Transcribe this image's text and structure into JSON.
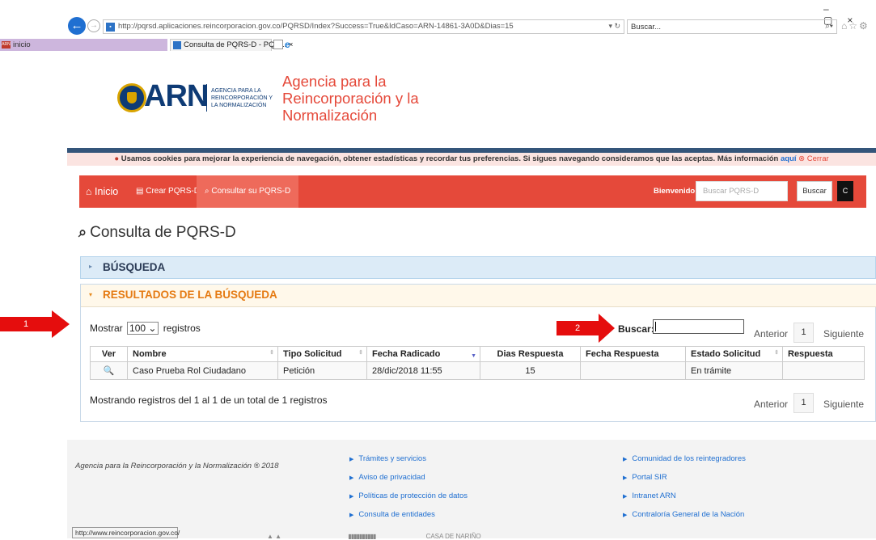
{
  "browser": {
    "url": "http://pqrsd.aplicaciones.reincorporacion.gov.co/PQRSD/Index?Success=True&IdCaso=ARN-14861-3A0D&Dias=15",
    "search_placeholder": "Buscar...",
    "address_controls": "▾ ↻",
    "fav_inicio": "inicio",
    "fav_inicio_logo": "ARN",
    "tab_title": "Consulta de PQRS-D - PQR... ×",
    "status_url": "http://www.reincorporacion.gov.co/"
  },
  "header": {
    "logo_text": "ARN",
    "logo_sub": "AGENCIA PARA LA REINCORPORACIÓN Y LA NORMALIZACIÓN",
    "agency_title": "Agencia para la Reincorporación y la Normalización"
  },
  "cookie": {
    "text": "Usamos cookies para mejorar la experiencia de navegación, obtener estadísticas y recordar tus preferencias. Si sigues navegando consideramos que las aceptas. Más información",
    "link": "aquí",
    "close": "Cerrar"
  },
  "nav": {
    "inicio": "Inicio",
    "crear": "Crear PQRS-D",
    "consultar": "Consultar su PQRS-D",
    "bienvenido": "Bienvenido",
    "search_placeholder": "Buscar PQRS-D",
    "buscar_btn": "Buscar",
    "c_btn": "C"
  },
  "page": {
    "title": "Consulta de PQRS-D"
  },
  "panels": {
    "busqueda": "BÚSQUEDA",
    "resultados": "RESULTADOS DE LA BÚSQUEDA"
  },
  "controls": {
    "mostrar": "Mostrar",
    "page_size": "100",
    "registros": "registros",
    "buscar": "Buscar:",
    "anterior": "Anterior",
    "page": "1",
    "siguiente": "Siguiente"
  },
  "table": {
    "headers": [
      "Ver",
      "Nombre",
      "Tipo Solicitud",
      "Fecha Radicado",
      "Dias Respuesta",
      "Fecha Respuesta",
      "Estado Solicitud",
      "Respuesta"
    ],
    "rows": [
      [
        "🔍",
        "Caso Prueba Rol Ciudadano",
        "Petición",
        "28/dic/2018 11:55",
        "15",
        "",
        "En trámite",
        ""
      ]
    ]
  },
  "results_info": "Mostrando registros del 1 al 1 de un total de 1 registros",
  "annotations": {
    "first": "1",
    "second": "2"
  },
  "footer": {
    "copyright": "Agencia para la Reincorporación y la Normalización ® 2018",
    "links_col1": [
      "Trámites y servicios",
      "Aviso de privacidad",
      "Políticas de protección de datos",
      "Consulta de entidades"
    ],
    "links_col2": [
      "Comunidad de los reintegradores",
      "Portal SIR",
      "Intranet ARN",
      "Contraloría General de la Nación"
    ],
    "bottom_partial": "CASA DE NARIÑO"
  }
}
